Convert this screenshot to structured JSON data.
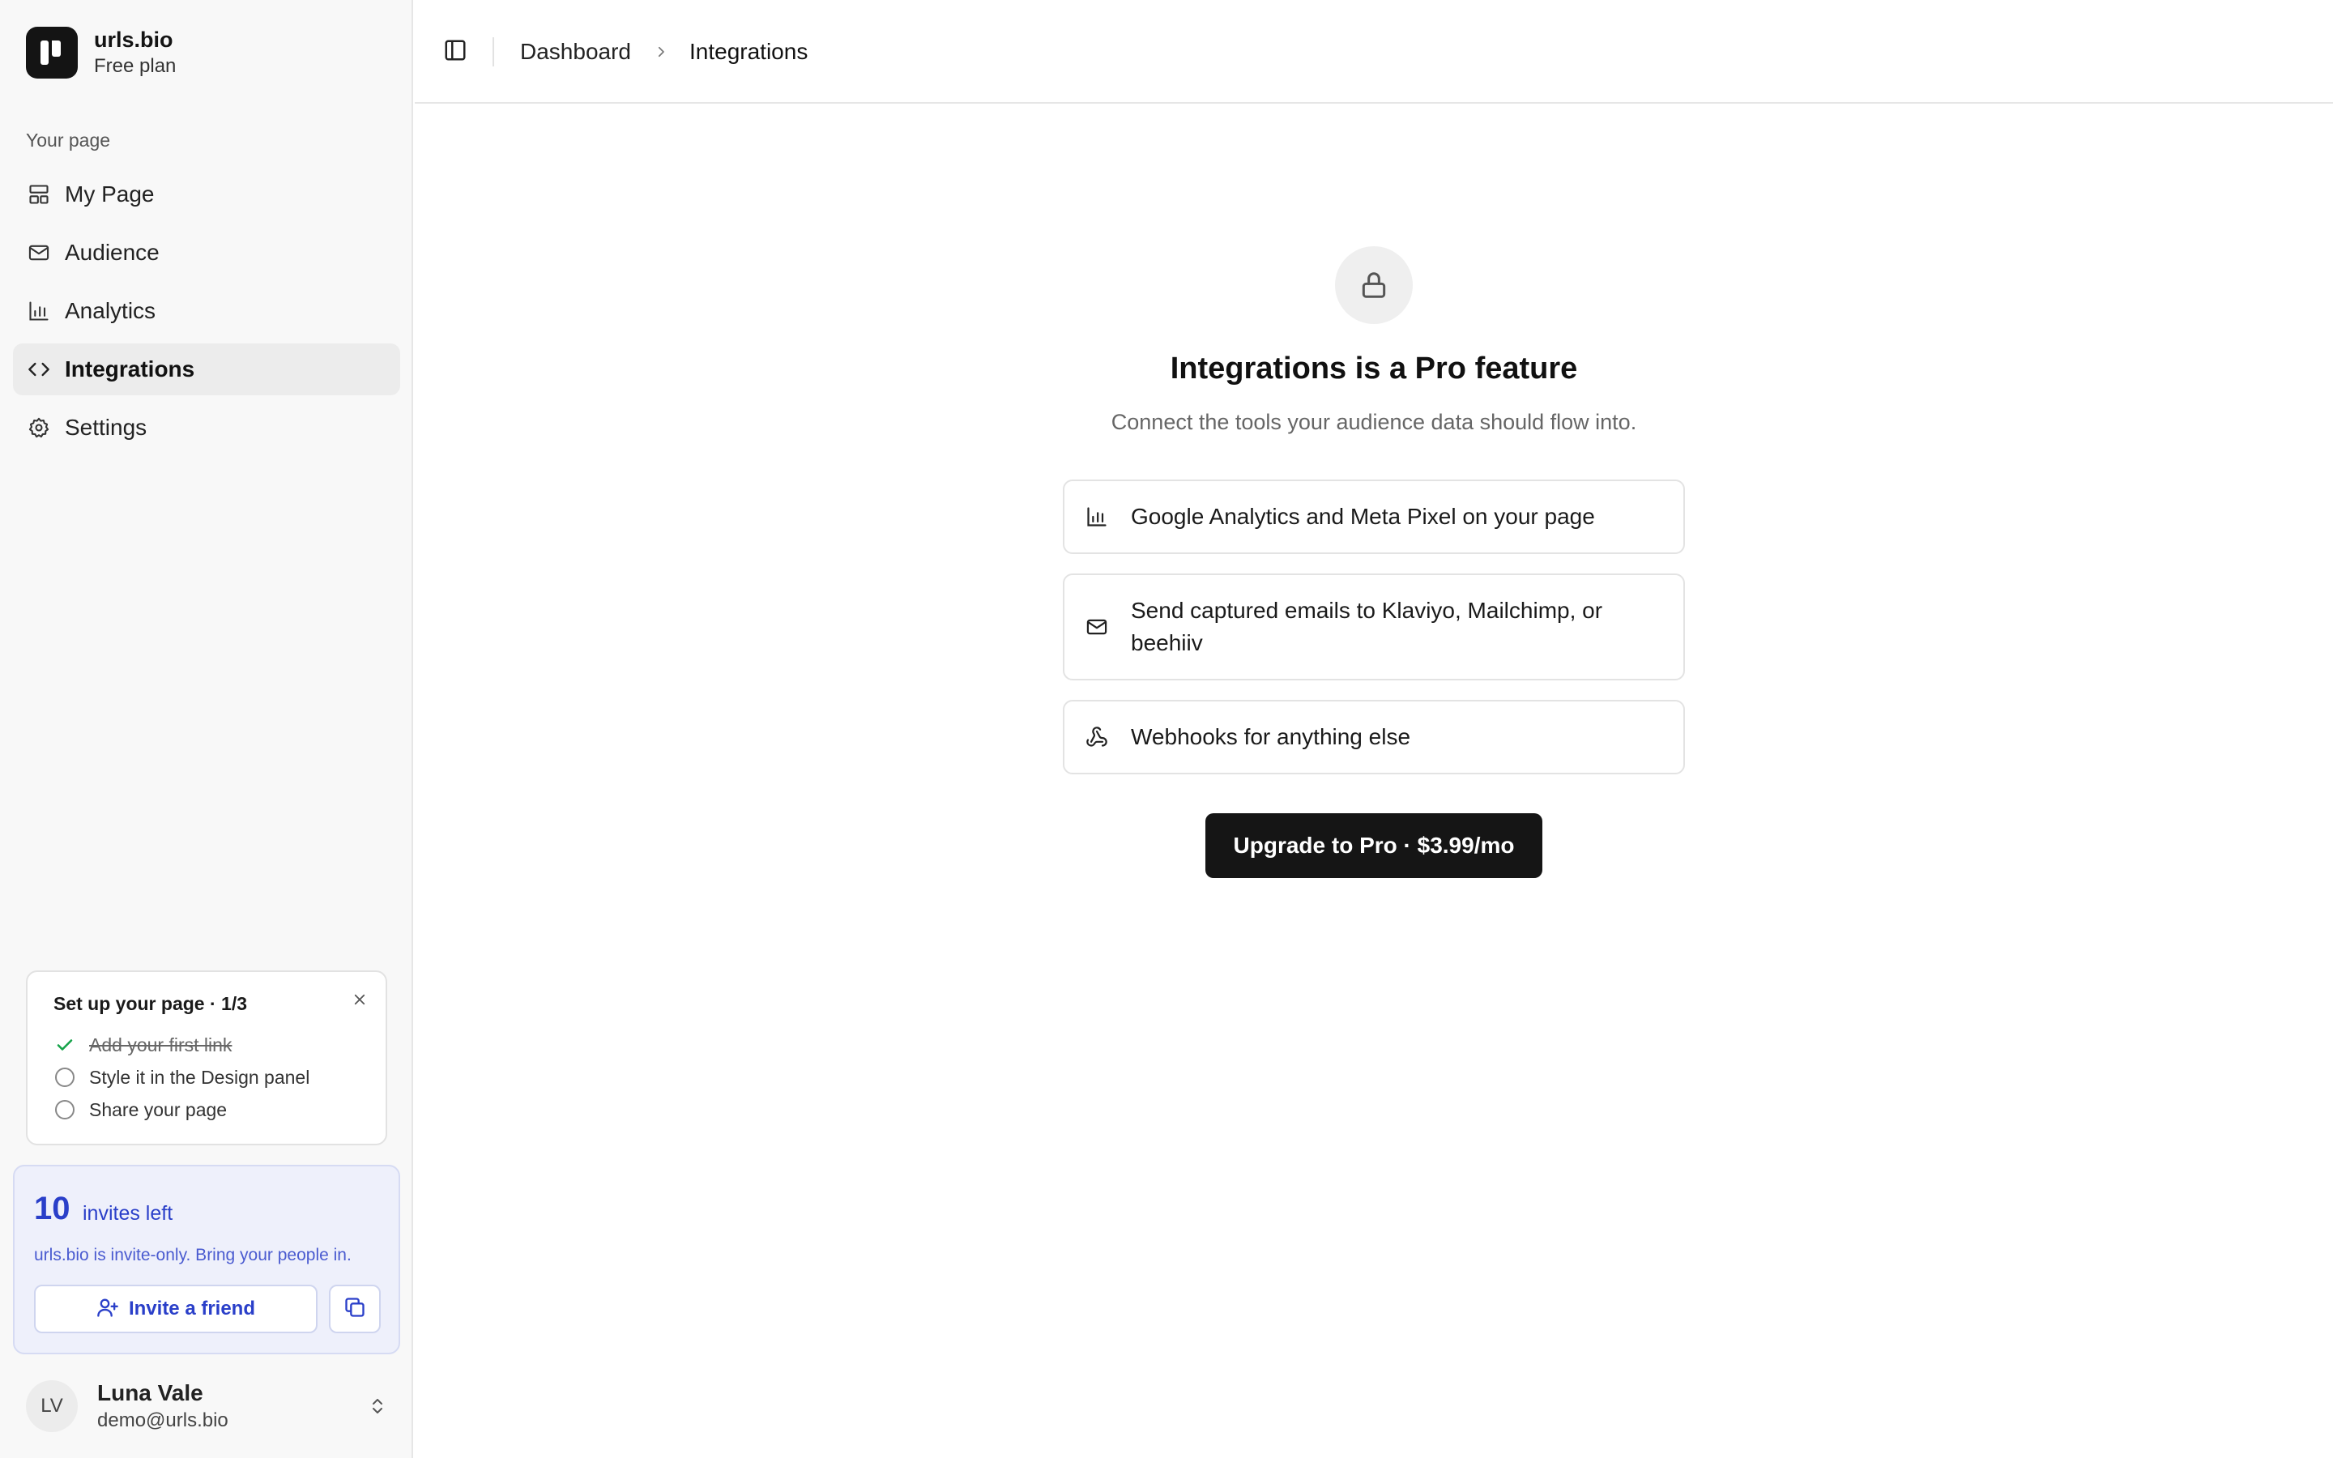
{
  "brand": {
    "name": "urls.bio",
    "plan": "Free plan"
  },
  "sidebar": {
    "section_label": "Your page",
    "items": [
      {
        "label": "My Page",
        "icon": "layout-icon"
      },
      {
        "label": "Audience",
        "icon": "mail-icon"
      },
      {
        "label": "Analytics",
        "icon": "bar-chart-icon"
      },
      {
        "label": "Integrations",
        "icon": "code-icon",
        "active": true
      },
      {
        "label": "Settings",
        "icon": "gear-icon"
      }
    ]
  },
  "setup": {
    "title": "Set up your page · 1/3",
    "steps": [
      {
        "label": "Add your first link",
        "done": true
      },
      {
        "label": "Style it in the Design panel",
        "done": false
      },
      {
        "label": "Share your page",
        "done": false
      }
    ]
  },
  "invite": {
    "count": "10",
    "count_label": "invites left",
    "description": "urls.bio is invite-only. Bring your people in.",
    "button_label": "Invite a friend"
  },
  "user": {
    "initials": "LV",
    "name": "Luna Vale",
    "email": "demo@urls.bio"
  },
  "breadcrumb": {
    "parent": "Dashboard",
    "current": "Integrations"
  },
  "main": {
    "title": "Integrations is a Pro feature",
    "subtitle": "Connect the tools your audience data should flow into.",
    "features": [
      {
        "label": "Google Analytics and Meta Pixel on your page",
        "icon": "bar-chart-icon"
      },
      {
        "label": "Send captured emails to Klaviyo, Mailchimp, or beehiiv",
        "icon": "mail-icon"
      },
      {
        "label": "Webhooks for anything else",
        "icon": "webhook-icon"
      }
    ],
    "cta": "Upgrade to Pro · $3.99/mo"
  },
  "colors": {
    "accent": "#2a3fc9",
    "dark": "#151515",
    "success": "#16a34a"
  }
}
